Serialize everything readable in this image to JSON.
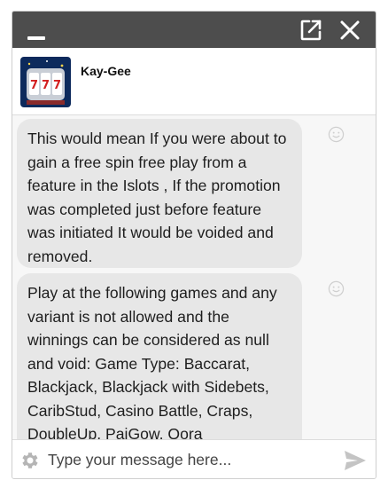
{
  "window": {
    "minimize_icon": "minimize-icon",
    "popout_icon": "open-in-new-window-icon",
    "close_icon": "close-icon",
    "titlebar_color": "#4d4d4d"
  },
  "header": {
    "agent_name": "Kay-Gee",
    "avatar_icon": "slot-machine-777-avatar"
  },
  "messages": [
    {
      "text": "This would mean If you were about to gain a free spin free play from a feature in the Islots , If the promotion was completed just before feature was initiated It would be voided and removed.",
      "reaction_icon": "smiley-icon"
    },
    {
      "text": "Play at the following games and any variant is not allowed and the winnings can be considered as null and void: Game Type: Baccarat, Blackjack, Blackjack with Sidebets, CaribStud, Casino Battle, Craps, DoubleUp, PaiGow, Qora Progressive,",
      "reaction_icon": "smiley-icon"
    }
  ],
  "composer": {
    "placeholder": "Type your message here...",
    "value": "",
    "settings_icon": "gear-icon",
    "send_icon": "send-icon"
  },
  "colors": {
    "bubble": "#e7e7e7",
    "background": "#f7f7f7",
    "text": "#1e1e1e"
  }
}
